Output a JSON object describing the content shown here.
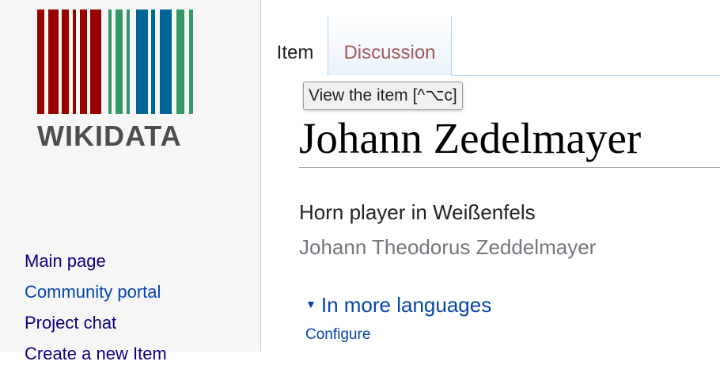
{
  "logo": {
    "text": "WIKIDATA",
    "colors": {
      "red": "#990000",
      "green": "#339966",
      "blue": "#006699"
    }
  },
  "sidebar": {
    "items": [
      {
        "label": "Main page"
      },
      {
        "label": "Community portal"
      },
      {
        "label": "Project chat"
      },
      {
        "label": "Create a new Item"
      }
    ]
  },
  "tabs": {
    "item": "Item",
    "discussion": "Discussion"
  },
  "tooltip": "View the item [^⌥c]",
  "item": {
    "title": "Johann Zedelmayer",
    "description": "Horn player in Weißenfels",
    "alias": "Johann Theodorus Zeddelmayer"
  },
  "languages": {
    "toggle": "In more languages",
    "configure": "Configure"
  }
}
